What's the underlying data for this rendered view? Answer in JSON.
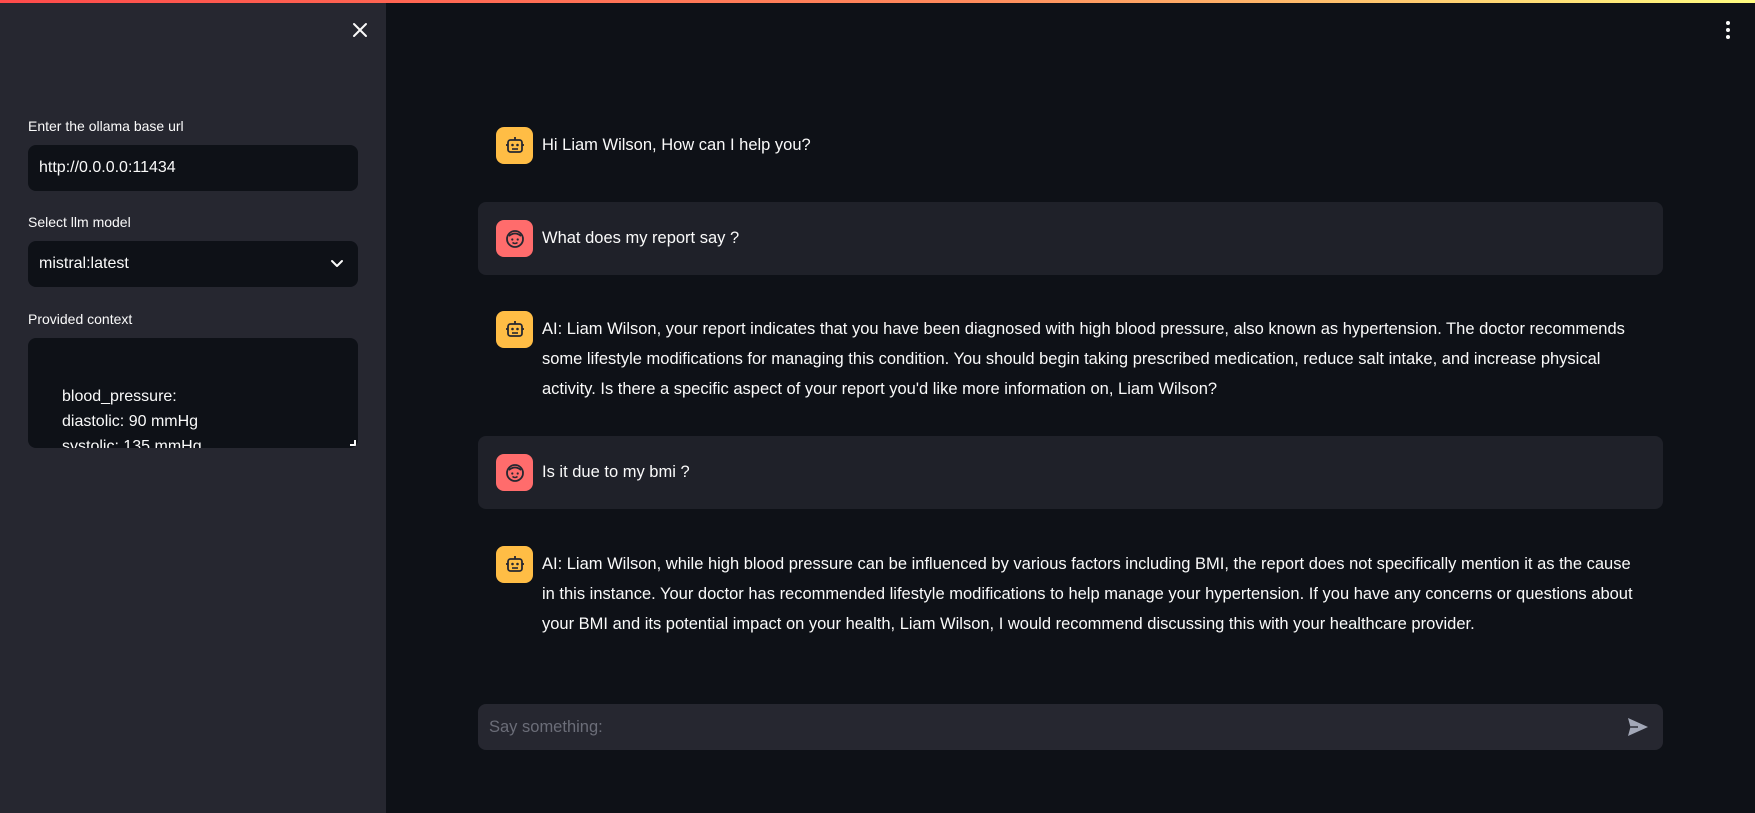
{
  "sidebar": {
    "base_url_label": "Enter the ollama base url",
    "base_url_value": "http://0.0.0.0:11434",
    "model_label": "Select llm model",
    "model_value": "mistral:latest",
    "context_label": "Provided context",
    "context_lines": [
      "blood_pressure:",
      "diastolic: 90 mmHg",
      "systolic: 135 mmHg"
    ]
  },
  "chat": {
    "messages": [
      {
        "role": "assistant",
        "avatar": "robot-icon",
        "text": "Hi Liam Wilson, How can I help you?"
      },
      {
        "role": "user",
        "avatar": "face-icon",
        "text": "What does my report say ?"
      },
      {
        "role": "assistant",
        "avatar": "robot-icon",
        "text": "AI: Liam Wilson, your report indicates that you have been diagnosed with high blood pressure, also known as hypertension. The doctor recommends some lifestyle modifications for managing this condition. You should begin taking prescribed medication, reduce salt intake, and increase physical activity. Is there a specific aspect of your report you'd like more information on, Liam Wilson?"
      },
      {
        "role": "user",
        "avatar": "face-icon",
        "text": "Is it due to my bmi ?"
      },
      {
        "role": "assistant",
        "avatar": "robot-icon",
        "text": "AI: Liam Wilson, while high blood pressure can be influenced by various factors including BMI, the report does not specifically mention it as the cause in this instance. Your doctor has recommended lifestyle modifications to help manage your hypertension. If you have any concerns or questions about your BMI and its potential impact on your health, Liam Wilson, I would recommend discussing this with your healthcare provider."
      }
    ],
    "input_placeholder": "Say something:"
  },
  "colors": {
    "sidebar_bg": "#262730",
    "main_bg": "#0e1117",
    "bot_avatar": "#ffbd45",
    "user_avatar": "#ff6c6c",
    "user_msg_bg": "#1f2129"
  }
}
